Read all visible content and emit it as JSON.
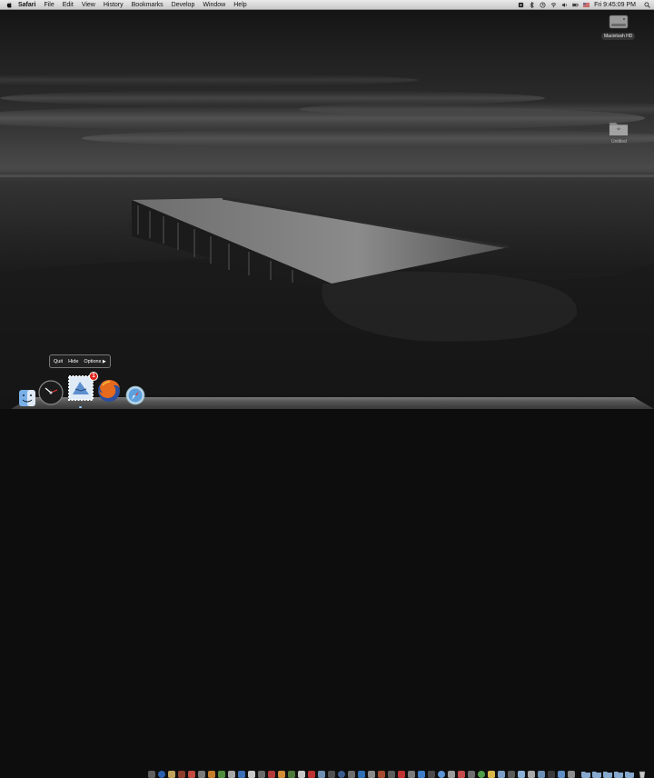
{
  "menubar": {
    "app_name": "Safari",
    "menus": [
      "File",
      "Edit",
      "View",
      "History",
      "Bookmarks",
      "Develop",
      "Window",
      "Help"
    ],
    "clock": "Fri 9:45:09 PM"
  },
  "desktop": {
    "drive_label": "Macintosh HD",
    "folder_label": "Untitled"
  },
  "dock": {
    "mail_badge": "1",
    "context_menu": {
      "quit": "Quit",
      "hide": "Hide",
      "options": "Options",
      "arrow": "▶"
    }
  },
  "colors": {
    "menubar": "#d8d8d8",
    "badge": "#e2231a"
  }
}
